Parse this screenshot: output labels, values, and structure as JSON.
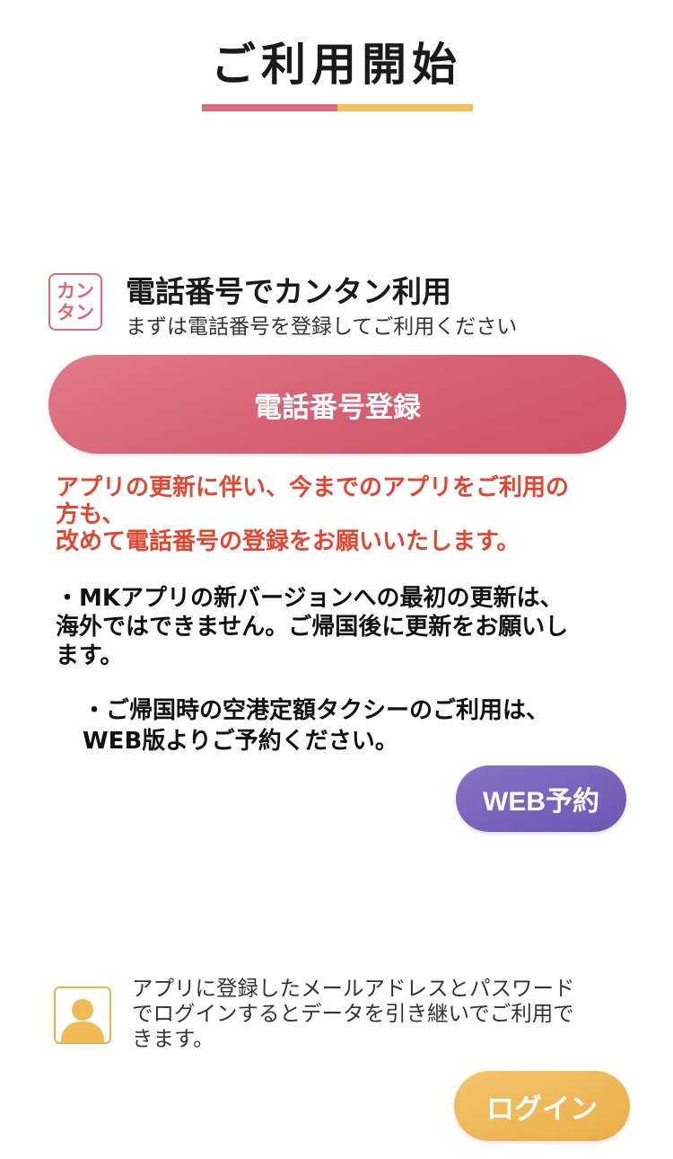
{
  "header": {
    "title": "ご利用開始"
  },
  "phone_section": {
    "badge_line1": "カン",
    "badge_line2": "タン",
    "heading": "電話番号でカンタン利用",
    "subtext": "まずは電話番号を登録してご利用ください",
    "register_button_label": "電話番号登録"
  },
  "notice": {
    "lines": [
      "アプリの更新に伴い、今までのアプリをご利用の",
      "方も、",
      "改めて電話番号の登録をお願いいたします。"
    ]
  },
  "info_update": {
    "lines": [
      "・MKアプリの新バージョンへの最初の更新は、",
      "海外ではできません。ご帰国後に更新をお願いし",
      "ます。"
    ]
  },
  "info_airport": {
    "lines": [
      "・ご帰国時の空港定額タクシーのご利用は、",
      "WEB版よりご予約ください。"
    ]
  },
  "web_reserve_button_label": "WEB予約",
  "login_section": {
    "lines": [
      "アプリに登録したメールアドレスとパスワード",
      "でログインするとデータを引き継いでご利用で",
      "きます。"
    ],
    "login_button_label": "ログイン"
  },
  "colors": {
    "accent_pink": "#d65f72",
    "accent_yellow": "#f1c15e",
    "accent_purple": "#6d56b2",
    "notice_red": "#e5442f"
  },
  "icons": {
    "kantan_badge": "kantan-badge-icon",
    "user_avatar": "user-avatar-icon"
  }
}
